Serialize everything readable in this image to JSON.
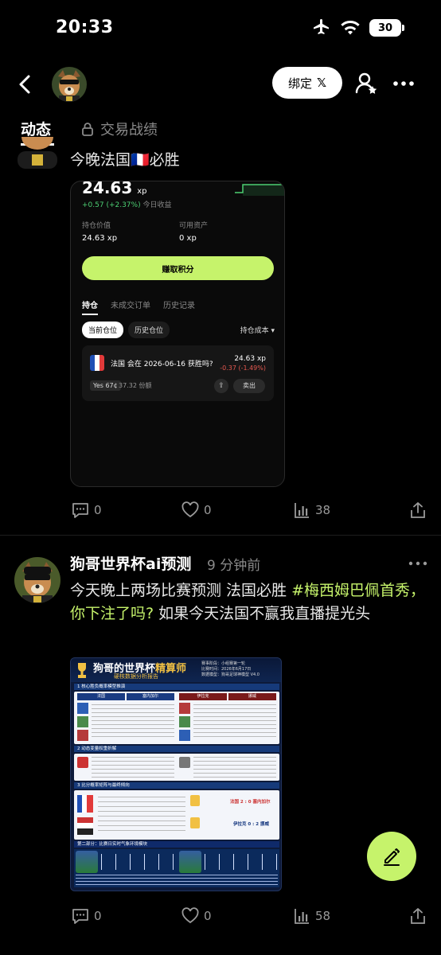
{
  "status_bar": {
    "time": "20:33",
    "battery": "30"
  },
  "header": {
    "bind_label": "绑定",
    "bind_x": "𝕏"
  },
  "tabs": {
    "active": "动态",
    "locked": "交易战绩"
  },
  "post1": {
    "text": "今晚法国🇫🇷必胜",
    "embed": {
      "value": "24.63",
      "unit": "xp",
      "change": "+0.57 (+2.37%)",
      "change_suffix": "今日收益",
      "label_hold": "持仓价值",
      "label_avail": "可用资产",
      "val_hold": "24.63 xp",
      "val_avail": "0 xp",
      "earn_button": "赚取积分",
      "tabs": [
        "持仓",
        "未成交订单",
        "历史记录"
      ],
      "pill_on": "当前仓位",
      "pill_off": "历史仓位",
      "cost": "持仓成本 ▾",
      "question": "法国 会在 2026-06-16 获胜吗?",
      "q_value": "24.63 xp",
      "q_change": "-0.37 (-1.49%)",
      "yes": "Yes 67¢",
      "shares": "37.32 份额",
      "sell": "卖出"
    },
    "comments": "0",
    "likes": "0",
    "views": "38"
  },
  "post2": {
    "name": "狗哥世界杯ai预测",
    "time": "9 分钟前",
    "text_a": "今天晚上两场比赛预测 法国必胜 ",
    "hashtag": "#梅西姆巴佩首秀，你下注了吗?",
    "text_b": " 如果今天法国不赢我直播提光头",
    "poster": {
      "title_a": "狗哥的世界杯",
      "title_b": "精算师",
      "subtitle": "硬核数据分析报告",
      "info": [
        "赛事阶段：小组赛第一轮",
        "比赛时间：2026年6月17日",
        "数据模型：狗哥足球神模型 V4.0"
      ],
      "sec1": "1  核心胜负概率模型推演",
      "team_a": "法国",
      "team_b": "塞内加尔",
      "team_c": "伊拉克",
      "team_d": "挪威",
      "sec2": "2  动态变量权重折解",
      "sec3": "3  比分概率矩阵与最终倾向",
      "pick1": "法国 2 : 0 塞内加尔",
      "pick2": "伊拉克 0 : 2 挪威",
      "sec4": "第二部分：比赛日实时气象环境模块"
    },
    "comments": "0",
    "likes": "0",
    "views": "58"
  }
}
